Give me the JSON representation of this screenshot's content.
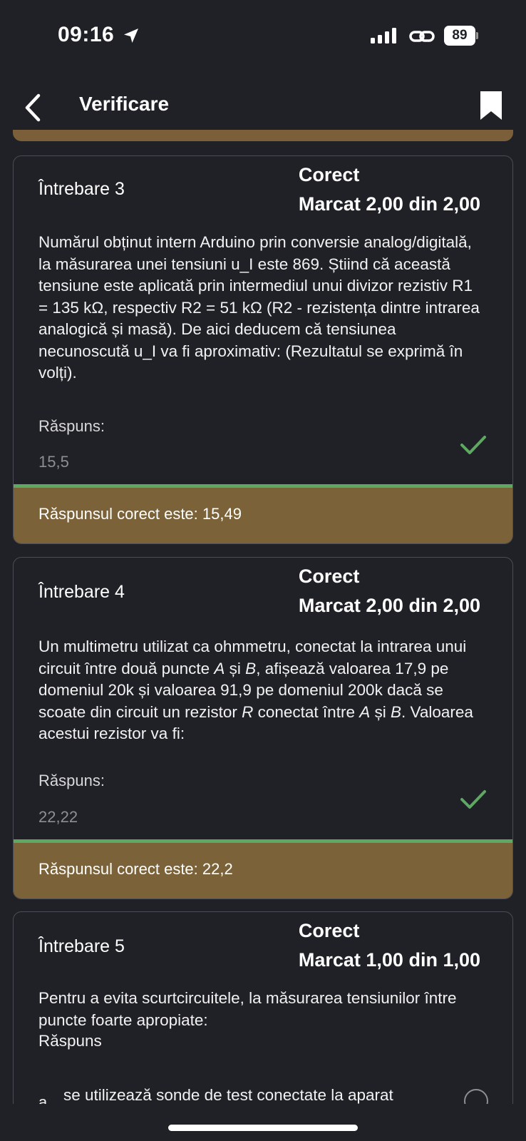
{
  "status_bar": {
    "time": "09:16",
    "battery": "89",
    "icons": [
      "location-arrow-icon",
      "signal-icon",
      "link-icon",
      "battery-icon"
    ]
  },
  "nav": {
    "title": "Verificare",
    "back_icon": "chevron-left-icon",
    "bookmark_icon": "bookmark-icon"
  },
  "questions": [
    {
      "title": "Întrebare 3",
      "status": "Corect",
      "mark": "Marcat 2,00 din 2,00",
      "text": "Numărul obținut intern Arduino prin conversie analog/digitală, la măsurarea unei tensiuni u_I este 869. Știind că această tensiune este aplicată prin intermediul unui divizor rezistiv R1 =  135 kΩ, respectiv R2 = 51 kΩ (R2 - rezistența dintre intrarea analogică și masă). De aici deducem că tensiunea necunoscută u_I va fi aproximativ: (Rezultatul se exprimă în volți).",
      "answer_label": "Răspuns:",
      "answer_value": "15,5",
      "feedback": "Răspunsul corect este: 15,49"
    },
    {
      "title": "Întrebare 4",
      "status": "Corect",
      "mark": "Marcat 2,00 din 2,00",
      "text_parts": [
        "Un multimetru utilizat ca ohmmetru, conectat la intrarea unui circuit între două puncte ",
        "A",
        " și ",
        "B",
        ", afișează valoarea 17,9 pe domeniul 20k și valoarea 91,9 pe domeniul 200k dacă se scoate din circuit un rezistor ",
        "R",
        " conectat între ",
        "A",
        " și ",
        "B",
        ". Valoarea acestui rezistor va fi:"
      ],
      "answer_label": "Răspuns:",
      "answer_value": "22,22",
      "feedback": "Răspunsul corect este: 22,2"
    },
    {
      "title": "Întrebare 5",
      "status": "Corect",
      "mark": "Marcat 1,00 din 1,00",
      "text": "Pentru a evita scurtcircuitele, la măsurarea tensiunilor între puncte foarte apropiate:",
      "answer_label": "Răspuns",
      "option_bullet": "a.",
      "option_text": "se utilizează sonde de test conectate la aparat"
    }
  ],
  "colors": {
    "background": "#1f2127",
    "feedback_bg": "#7c6238",
    "correct_green": "#5ea862",
    "card_border": "#4a4d55"
  }
}
